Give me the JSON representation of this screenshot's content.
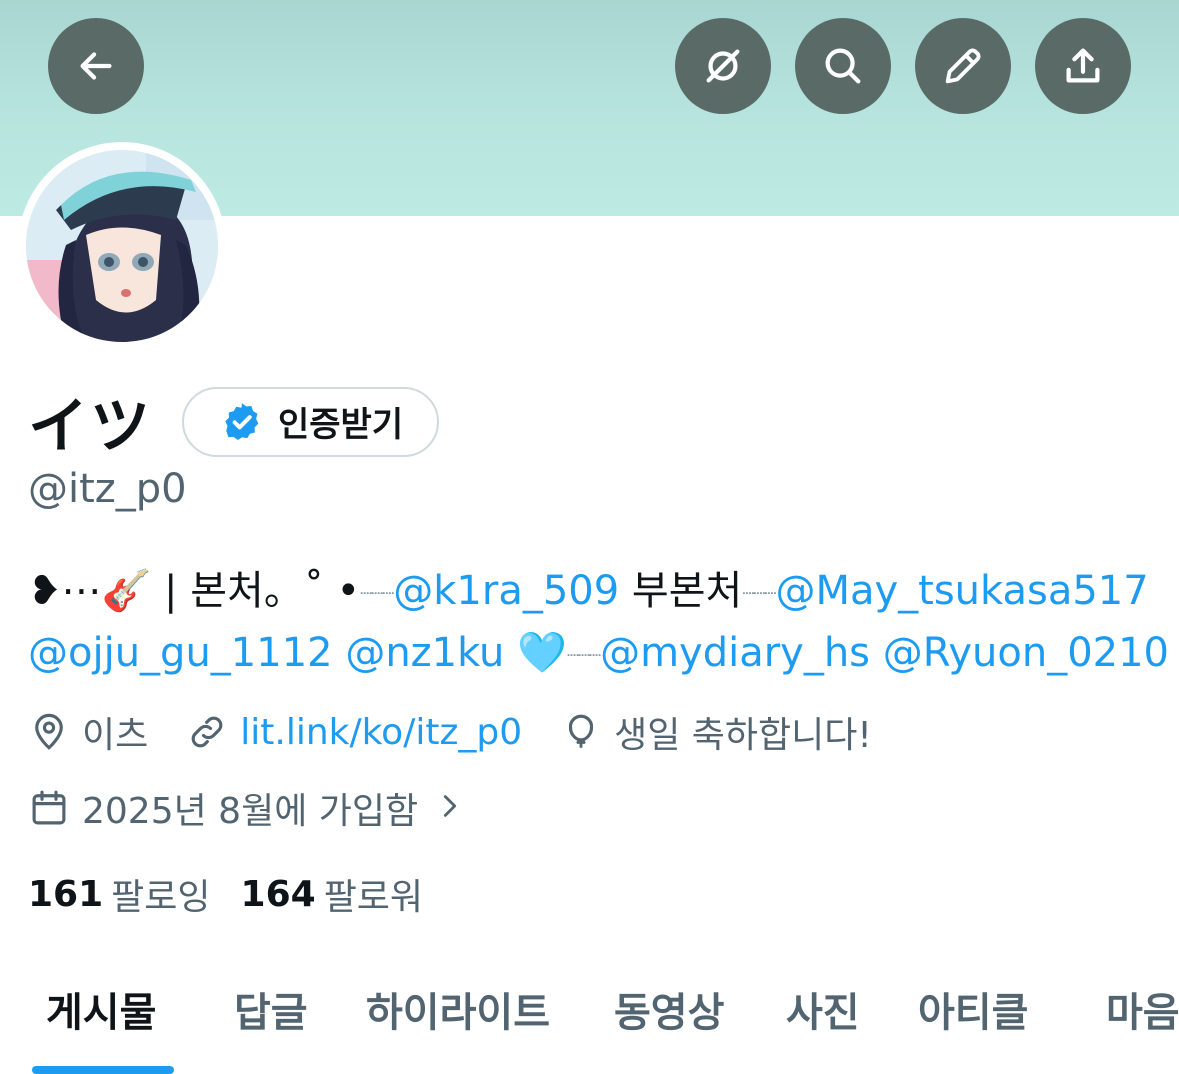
{
  "profile": {
    "display_name": "イツ",
    "verify_label": "인증받기",
    "handle": "@itz_p0"
  },
  "bio": {
    "line1_prefix": "❥⋯🎸 | 본처。˚ •",
    "line1_mention1": "@k1ra_509",
    "line1_mid": " 부본처",
    "line1_mention2": "@May_tsukasa517",
    "line2_mention1": "@ojju_gu_1112",
    "line2_mention2": "@nz1ku",
    "line2_emoji": "🩵",
    "line2_mention3": "@mydiary_hs",
    "line2_mention4": "@Ryuon_0210"
  },
  "meta": {
    "location": "이츠",
    "link": "lit.link/ko/itz_p0",
    "birthday": "생일 축하합니다!",
    "joined": "2025년 8월에 가입함"
  },
  "stats": {
    "following_count": "161",
    "following_label": "팔로잉",
    "followers_count": "164",
    "followers_label": "팔로워"
  },
  "tabs": [
    {
      "label": "게시물",
      "active": true
    },
    {
      "label": "답글",
      "active": false
    },
    {
      "label": "하이라이트",
      "active": false
    },
    {
      "label": "동영상",
      "active": false
    },
    {
      "label": "사진",
      "active": false
    },
    {
      "label": "아티클",
      "active": false
    },
    {
      "label": "마음",
      "active": false
    }
  ],
  "icons": {
    "back": "back-arrow-icon",
    "grok": "grok-icon",
    "search": "search-icon",
    "edit": "pencil-icon",
    "share": "share-icon",
    "verified": "verified-badge-icon",
    "location": "location-pin-icon",
    "link": "link-icon",
    "birthday": "balloon-icon",
    "calendar": "calendar-icon"
  },
  "colors": {
    "accent": "#1d9bf0",
    "secondary_text": "#536471",
    "banner": "#b8e6df",
    "icon_button": "#5a6b67"
  }
}
